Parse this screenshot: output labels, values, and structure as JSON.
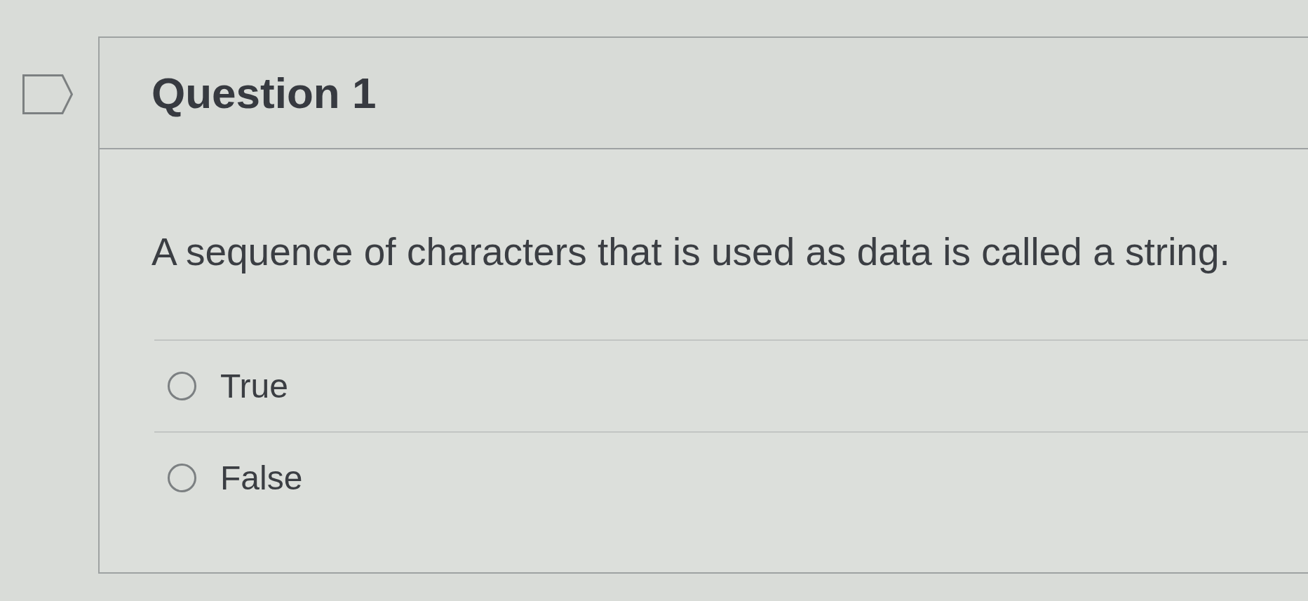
{
  "question": {
    "title": "Question 1",
    "flagged": false,
    "text": "A sequence of characters that is used as data is called a string.",
    "options": [
      {
        "label": "True",
        "selected": false
      },
      {
        "label": "False",
        "selected": false
      }
    ]
  }
}
